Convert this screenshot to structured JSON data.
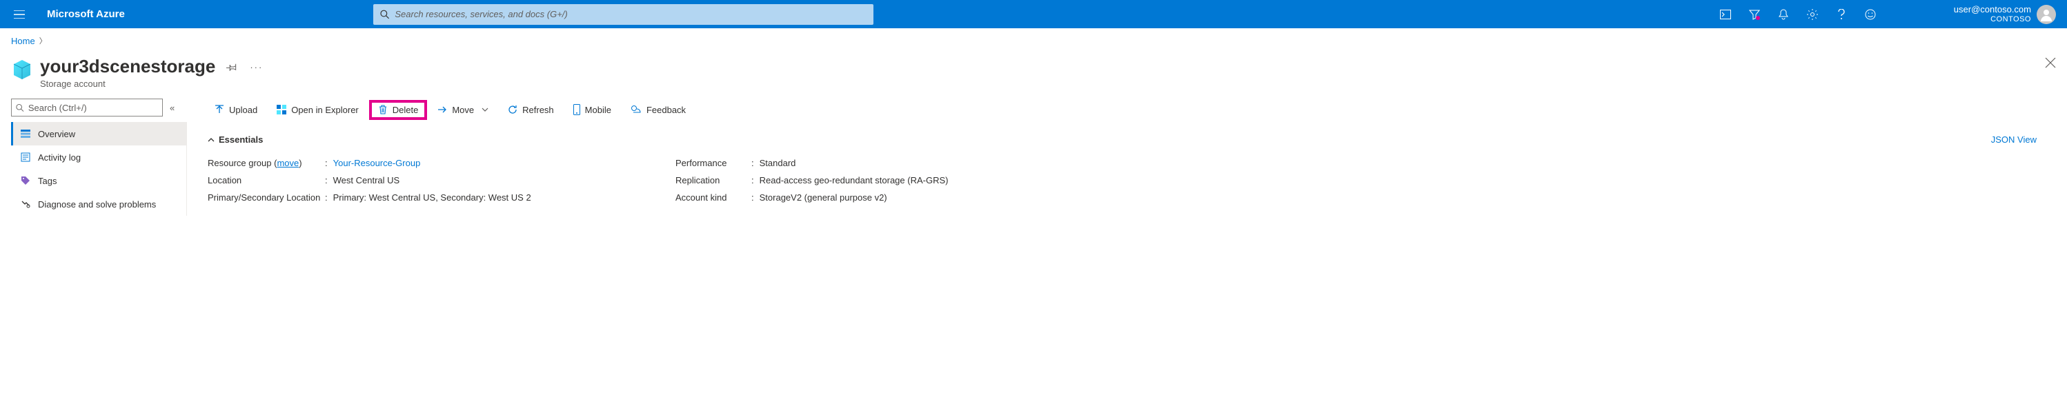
{
  "header": {
    "brand": "Microsoft Azure",
    "search_placeholder": "Search resources, services, and docs (G+/)",
    "user_email": "user@contoso.com",
    "tenant": "CONTOSO"
  },
  "breadcrumb": {
    "root": "Home"
  },
  "resource": {
    "title": "your3dscenestorage",
    "subtitle": "Storage account"
  },
  "sidebar": {
    "search_placeholder": "Search (Ctrl+/)",
    "items": [
      {
        "label": "Overview"
      },
      {
        "label": "Activity log"
      },
      {
        "label": "Tags"
      },
      {
        "label": "Diagnose and solve problems"
      }
    ]
  },
  "toolbar": {
    "upload": "Upload",
    "open_in_explorer": "Open in Explorer",
    "delete": "Delete",
    "move": "Move",
    "refresh": "Refresh",
    "mobile": "Mobile",
    "feedback": "Feedback"
  },
  "essentials": {
    "title": "Essentials",
    "json_view": "JSON View",
    "move_label": "move",
    "left": [
      {
        "label": "Resource group",
        "value": "Your-Resource-Group",
        "link": true,
        "has_move": true
      },
      {
        "label": "Location",
        "value": "West Central US"
      },
      {
        "label": "Primary/Secondary Location",
        "value": "Primary: West Central US, Secondary: West US 2"
      }
    ],
    "right": [
      {
        "label": "Performance",
        "value": "Standard"
      },
      {
        "label": "Replication",
        "value": "Read-access geo-redundant storage (RA-GRS)"
      },
      {
        "label": "Account kind",
        "value": "StorageV2 (general purpose v2)"
      }
    ]
  }
}
